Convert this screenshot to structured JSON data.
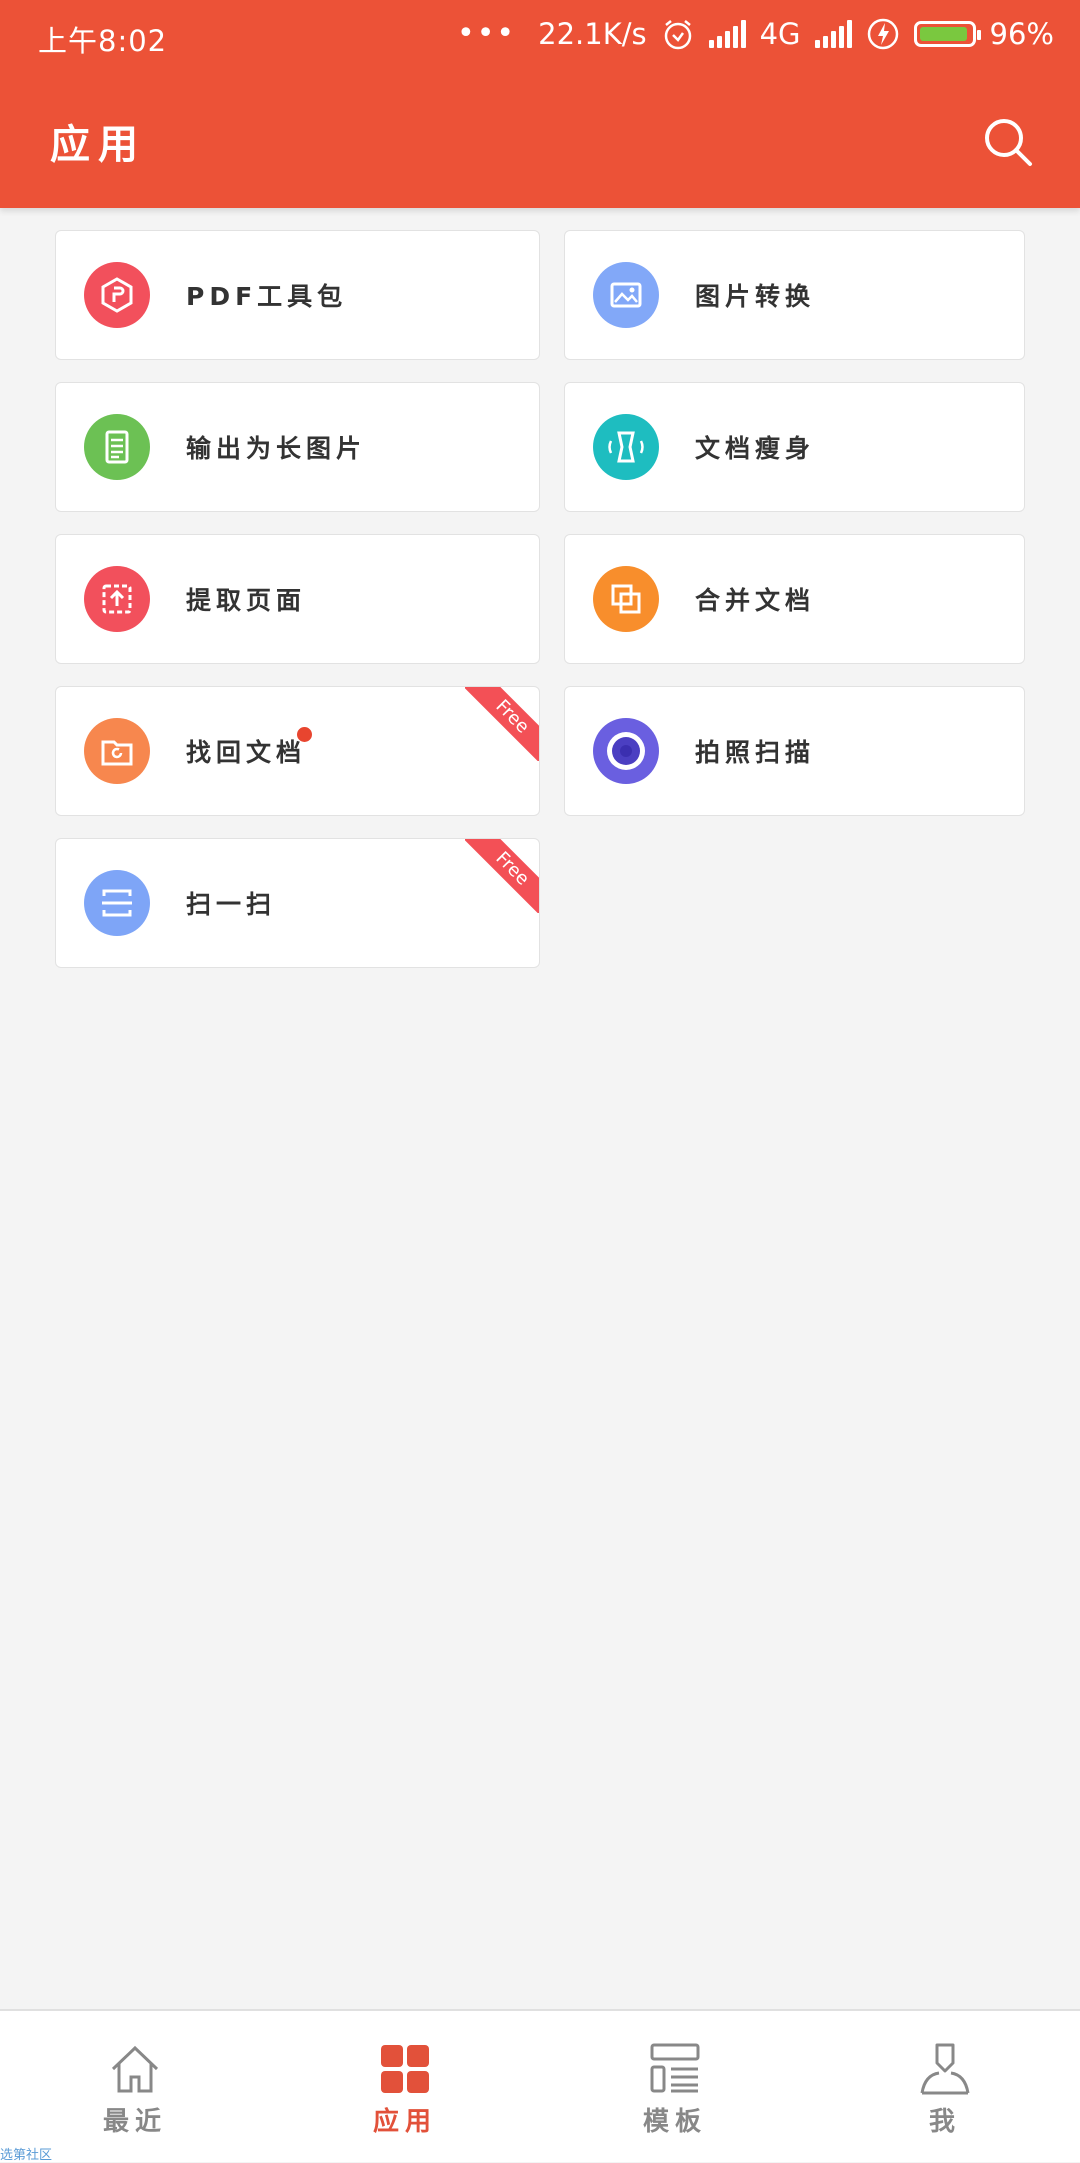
{
  "status_bar": {
    "time": "上午8:02",
    "dots": "•••",
    "net_speed": "22.1K/s",
    "network": "4G",
    "battery": "96%",
    "battery_level": 0.96
  },
  "header": {
    "title": "应用",
    "search_icon": "search-icon"
  },
  "apps": [
    {
      "label": "PDF工具包",
      "color": "#f2505c",
      "icon": "pdf-toolkit-icon"
    },
    {
      "label": "图片转换",
      "color": "#82a8f8",
      "icon": "image-convert-icon"
    },
    {
      "label": "输出为长图片",
      "color": "#6cc154",
      "icon": "long-image-icon"
    },
    {
      "label": "文档瘦身",
      "color": "#1ebdc0",
      "icon": "slim-doc-icon"
    },
    {
      "label": "提取页面",
      "color": "#f2505c",
      "icon": "extract-page-icon"
    },
    {
      "label": "合并文档",
      "color": "#f88e2c",
      "icon": "merge-doc-icon"
    },
    {
      "label": "找回文档",
      "color": "#f7874e",
      "icon": "recover-doc-icon",
      "badge": "Free"
    },
    {
      "label": "拍照扫描",
      "color": "#6a5fe0",
      "icon": "camera-scan-icon"
    },
    {
      "label": "扫一扫",
      "color": "#7ea5f7",
      "icon": "scan-icon",
      "badge": "Free"
    }
  ],
  "tabs": [
    {
      "label": "最近",
      "icon": "home-icon"
    },
    {
      "label": "应用",
      "icon": "apps-grid-icon",
      "active": true
    },
    {
      "label": "模板",
      "icon": "template-icon"
    },
    {
      "label": "我",
      "icon": "profile-icon"
    }
  ],
  "watermark": "选第社区",
  "colors": {
    "accent": "#ec5237",
    "tab_active": "#e2513a",
    "background": "#f4f4f4"
  }
}
